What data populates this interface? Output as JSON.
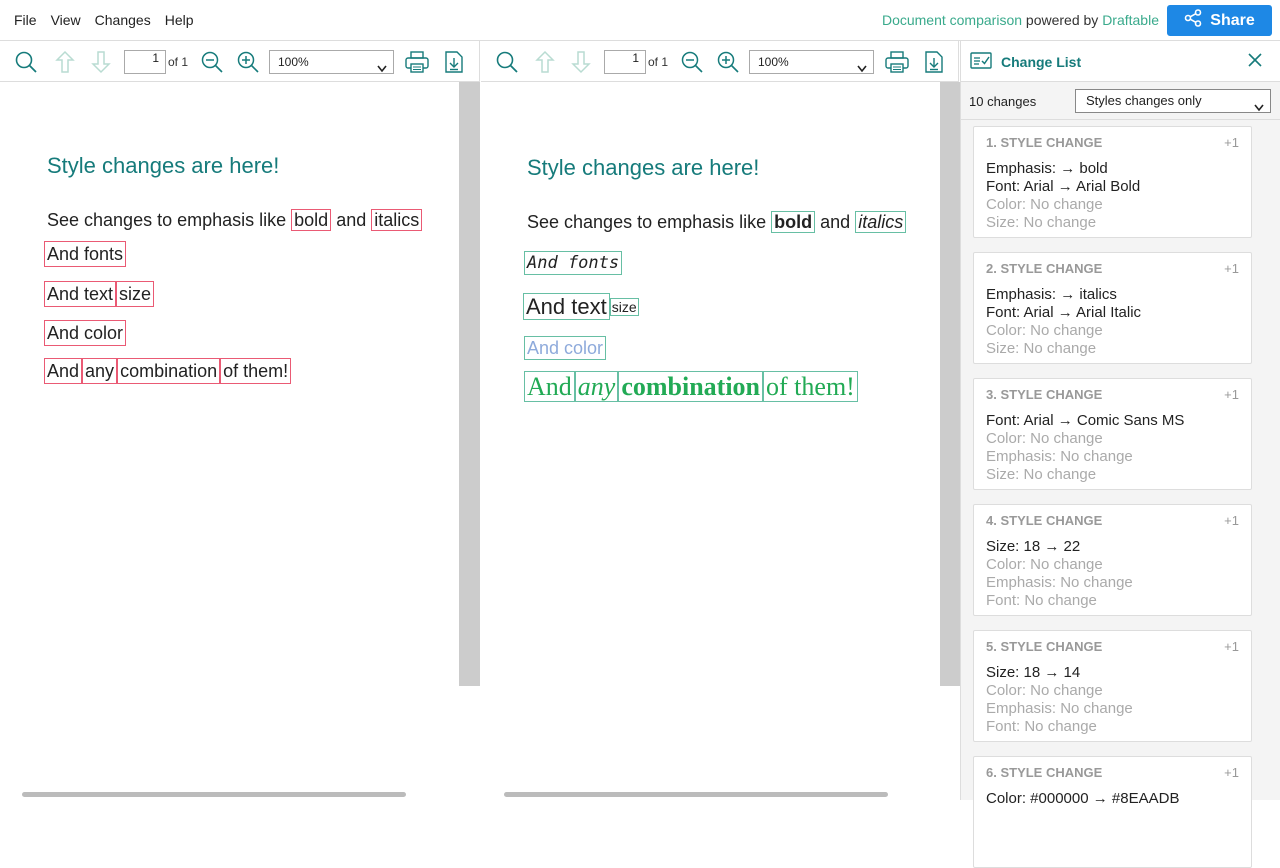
{
  "menu": {
    "file": "File",
    "view": "View",
    "changes": "Changes",
    "help": "Help"
  },
  "brand": {
    "product": "Document comparison",
    "powered": " powered by ",
    "company": "Draftable"
  },
  "share": {
    "label": "Share"
  },
  "left_toolbar": {
    "page_value": "1",
    "page_of": "of 1",
    "zoom": "100%"
  },
  "right_toolbar": {
    "page_value": "1",
    "page_of": "of 1",
    "zoom": "100%"
  },
  "left_doc": {
    "title": "Style changes are here!",
    "line1_prefix": "See changes to emphasis like ",
    "line1_bold": "bold",
    "line1_and": " and ",
    "line1_italics": "italics",
    "line2": "And fonts",
    "line3_a": "And text",
    "line3_b": "size",
    "line4": "And color",
    "line5_a": "And",
    "line5_b": "any",
    "line5_c": "combination",
    "line5_d": "of them!"
  },
  "right_doc": {
    "title": "Style changes are here!",
    "line1_prefix": "See changes to emphasis like ",
    "line1_bold": "bold",
    "line1_and": " and ",
    "line1_italics": "italics",
    "line2": "And fonts",
    "line3_a": "And text",
    "line3_b": "size",
    "line4": "And color",
    "line5_a": "And",
    "line5_b": "any",
    "line5_c": "combination",
    "line5_d": "of them!"
  },
  "colors": {
    "highlight_deleted": "#ea5a74",
    "highlight_inserted": "#67bfa4",
    "accent": "#167b7b",
    "share_bg": "#1e88e5",
    "changed_color": "#8EAADB",
    "combo_green": "#22aa55"
  },
  "sidebar": {
    "title": "Change List",
    "count": "10 changes",
    "filter": "Styles changes only",
    "cards": [
      {
        "head": "1. STYLE CHANGE",
        "plus": "+1",
        "lines": [
          "Emphasis: → bold",
          "Font: Arial → Arial Bold"
        ],
        "muted": [
          "Color: No change",
          "Size: No change"
        ]
      },
      {
        "head": "2. STYLE CHANGE",
        "plus": "+1",
        "lines": [
          "Emphasis: → italics",
          "Font: Arial → Arial Italic"
        ],
        "muted": [
          "Color: No change",
          "Size: No change"
        ]
      },
      {
        "head": "3. STYLE CHANGE",
        "plus": "+1",
        "lines": [
          "Font: Arial → Comic Sans MS"
        ],
        "muted": [
          "Color: No change",
          "Emphasis: No change",
          "Size: No change"
        ]
      },
      {
        "head": "4. STYLE CHANGE",
        "plus": "+1",
        "lines": [
          "Size: 18 → 22"
        ],
        "muted": [
          "Color: No change",
          "Emphasis: No change",
          "Font: No change"
        ]
      },
      {
        "head": "5. STYLE CHANGE",
        "plus": "+1",
        "lines": [
          "Size: 18 → 14"
        ],
        "muted": [
          "Color: No change",
          "Emphasis: No change",
          "Font: No change"
        ]
      },
      {
        "head": "6. STYLE CHANGE",
        "plus": "+1",
        "lines": [
          "Color: #000000 → #8EAADB"
        ],
        "muted": []
      }
    ]
  }
}
